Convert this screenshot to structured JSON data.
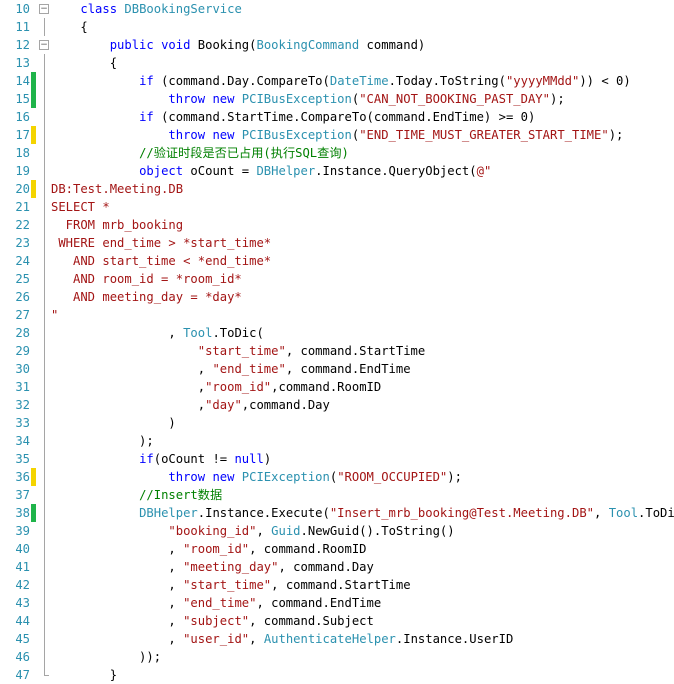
{
  "editor": {
    "colors": {
      "keyword": "#0000ff",
      "type": "#2b91af",
      "string": "#a31515",
      "comment": "#008000",
      "line_number": "#2b91af",
      "change_saved": "#1fb44a",
      "change_unsaved": "#f4d400"
    },
    "lines": [
      {
        "num": "10",
        "fold": "minus",
        "change": "",
        "code": [
          [
            "    ",
            "pl"
          ],
          [
            "class",
            "kw"
          ],
          [
            " ",
            "pl"
          ],
          [
            "DBBookingService",
            "ty"
          ]
        ]
      },
      {
        "num": "11",
        "fold": "line",
        "change": "",
        "code": [
          [
            "    {",
            "pl"
          ]
        ]
      },
      {
        "num": "12",
        "fold": "minus",
        "change": "",
        "code": [
          [
            "        ",
            "pl"
          ],
          [
            "public",
            "kw"
          ],
          [
            " ",
            "pl"
          ],
          [
            "void",
            "kw"
          ],
          [
            " Booking(",
            "pl"
          ],
          [
            "BookingCommand",
            "ty"
          ],
          [
            " command)",
            "pl"
          ]
        ]
      },
      {
        "num": "13",
        "fold": "line",
        "change": "",
        "code": [
          [
            "        {",
            "pl"
          ]
        ]
      },
      {
        "num": "14",
        "fold": "line",
        "change": "green",
        "code": [
          [
            "            ",
            "pl"
          ],
          [
            "if",
            "kw"
          ],
          [
            " (command.Day.CompareTo(",
            "pl"
          ],
          [
            "DateTime",
            "ty"
          ],
          [
            ".Today.ToString(",
            "pl"
          ],
          [
            "\"yyyyMMdd\"",
            "st"
          ],
          [
            ")) < 0)",
            "pl"
          ]
        ]
      },
      {
        "num": "15",
        "fold": "line",
        "change": "green",
        "code": [
          [
            "                ",
            "pl"
          ],
          [
            "throw",
            "kw"
          ],
          [
            " ",
            "pl"
          ],
          [
            "new",
            "kw"
          ],
          [
            " ",
            "pl"
          ],
          [
            "PCIBusException",
            "ty"
          ],
          [
            "(",
            "pl"
          ],
          [
            "\"CAN_NOT_BOOKING_PAST_DAY\"",
            "st"
          ],
          [
            ");",
            "pl"
          ]
        ]
      },
      {
        "num": "16",
        "fold": "line",
        "change": "",
        "code": [
          [
            "            ",
            "pl"
          ],
          [
            "if",
            "kw"
          ],
          [
            " (command.StartTime.CompareTo(command.EndTime) >= 0)",
            "pl"
          ]
        ]
      },
      {
        "num": "17",
        "fold": "line",
        "change": "yellow",
        "code": [
          [
            "                ",
            "pl"
          ],
          [
            "throw",
            "kw"
          ],
          [
            " ",
            "pl"
          ],
          [
            "new",
            "kw"
          ],
          [
            " ",
            "pl"
          ],
          [
            "PCIBusException",
            "ty"
          ],
          [
            "(",
            "pl"
          ],
          [
            "\"END_TIME_MUST_GREATER_START_TIME\"",
            "st"
          ],
          [
            ");",
            "pl"
          ]
        ]
      },
      {
        "num": "18",
        "fold": "line",
        "change": "",
        "code": [
          [
            "            ",
            "pl"
          ],
          [
            "//验证时段是否已占用(执行SQL查询)",
            "cm"
          ]
        ]
      },
      {
        "num": "19",
        "fold": "line",
        "change": "",
        "code": [
          [
            "            ",
            "pl"
          ],
          [
            "object",
            "kw"
          ],
          [
            " oCount = ",
            "pl"
          ],
          [
            "DBHelper",
            "ty"
          ],
          [
            ".Instance.QueryObject(",
            "pl"
          ],
          [
            "@\"",
            "st"
          ]
        ]
      },
      {
        "num": "20",
        "fold": "line",
        "change": "yellow",
        "code": [
          [
            "DB:Test.Meeting.DB",
            "st"
          ]
        ]
      },
      {
        "num": "21",
        "fold": "line",
        "change": "",
        "code": [
          [
            "SELECT *",
            "st"
          ]
        ]
      },
      {
        "num": "22",
        "fold": "line",
        "change": "",
        "code": [
          [
            "  FROM mrb_booking",
            "st"
          ]
        ]
      },
      {
        "num": "23",
        "fold": "line",
        "change": "",
        "code": [
          [
            " WHERE end_time > *start_time*",
            "st"
          ]
        ]
      },
      {
        "num": "24",
        "fold": "line",
        "change": "",
        "code": [
          [
            "   AND start_time < *end_time*",
            "st"
          ]
        ]
      },
      {
        "num": "25",
        "fold": "line",
        "change": "",
        "code": [
          [
            "   AND room_id = *room_id*",
            "st"
          ]
        ]
      },
      {
        "num": "26",
        "fold": "line",
        "change": "",
        "code": [
          [
            "   AND meeting_day = *day*",
            "st"
          ]
        ]
      },
      {
        "num": "27",
        "fold": "line",
        "change": "",
        "code": [
          [
            "\"",
            "st"
          ]
        ]
      },
      {
        "num": "28",
        "fold": "line",
        "change": "",
        "code": [
          [
            "                , ",
            "pl"
          ],
          [
            "Tool",
            "ty"
          ],
          [
            ".ToDic(",
            "pl"
          ]
        ]
      },
      {
        "num": "29",
        "fold": "line",
        "change": "",
        "code": [
          [
            "                    ",
            "pl"
          ],
          [
            "\"start_time\"",
            "st"
          ],
          [
            ", command.StartTime",
            "pl"
          ]
        ]
      },
      {
        "num": "30",
        "fold": "line",
        "change": "",
        "code": [
          [
            "                    , ",
            "pl"
          ],
          [
            "\"end_time\"",
            "st"
          ],
          [
            ", command.EndTime",
            "pl"
          ]
        ]
      },
      {
        "num": "31",
        "fold": "line",
        "change": "",
        "code": [
          [
            "                    ,",
            "pl"
          ],
          [
            "\"room_id\"",
            "st"
          ],
          [
            ",command.RoomID",
            "pl"
          ]
        ]
      },
      {
        "num": "32",
        "fold": "line",
        "change": "",
        "code": [
          [
            "                    ,",
            "pl"
          ],
          [
            "\"day\"",
            "st"
          ],
          [
            ",command.Day",
            "pl"
          ]
        ]
      },
      {
        "num": "33",
        "fold": "line",
        "change": "",
        "code": [
          [
            "                )",
            "pl"
          ]
        ]
      },
      {
        "num": "34",
        "fold": "line",
        "change": "",
        "code": [
          [
            "            );",
            "pl"
          ]
        ]
      },
      {
        "num": "35",
        "fold": "line",
        "change": "",
        "code": [
          [
            "            ",
            "pl"
          ],
          [
            "if",
            "kw"
          ],
          [
            "(oCount != ",
            "pl"
          ],
          [
            "null",
            "kw"
          ],
          [
            ")",
            "pl"
          ]
        ]
      },
      {
        "num": "36",
        "fold": "line",
        "change": "yellow",
        "code": [
          [
            "                ",
            "pl"
          ],
          [
            "throw",
            "kw"
          ],
          [
            " ",
            "pl"
          ],
          [
            "new",
            "kw"
          ],
          [
            " ",
            "pl"
          ],
          [
            "PCIException",
            "ty"
          ],
          [
            "(",
            "pl"
          ],
          [
            "\"ROOM_OCCUPIED\"",
            "st"
          ],
          [
            ");",
            "pl"
          ]
        ]
      },
      {
        "num": "37",
        "fold": "line",
        "change": "",
        "code": [
          [
            "            ",
            "pl"
          ],
          [
            "//Insert数据",
            "cm"
          ]
        ]
      },
      {
        "num": "38",
        "fold": "line",
        "change": "green",
        "code": [
          [
            "            ",
            "pl"
          ],
          [
            "DBHelper",
            "ty"
          ],
          [
            ".Instance.Execute(",
            "pl"
          ],
          [
            "\"Insert_mrb_booking@Test.Meeting.DB\"",
            "st"
          ],
          [
            ", ",
            "pl"
          ],
          [
            "Tool",
            "ty"
          ],
          [
            ".ToDic(",
            "pl"
          ]
        ]
      },
      {
        "num": "39",
        "fold": "line",
        "change": "",
        "code": [
          [
            "                ",
            "pl"
          ],
          [
            "\"booking_id\"",
            "st"
          ],
          [
            ", ",
            "pl"
          ],
          [
            "Guid",
            "ty"
          ],
          [
            ".NewGuid().ToString()",
            "pl"
          ]
        ]
      },
      {
        "num": "40",
        "fold": "line",
        "change": "",
        "code": [
          [
            "                , ",
            "pl"
          ],
          [
            "\"room_id\"",
            "st"
          ],
          [
            ", command.RoomID",
            "pl"
          ]
        ]
      },
      {
        "num": "41",
        "fold": "line",
        "change": "",
        "code": [
          [
            "                , ",
            "pl"
          ],
          [
            "\"meeting_day\"",
            "st"
          ],
          [
            ", command.Day",
            "pl"
          ]
        ]
      },
      {
        "num": "42",
        "fold": "line",
        "change": "",
        "code": [
          [
            "                , ",
            "pl"
          ],
          [
            "\"start_time\"",
            "st"
          ],
          [
            ", command.StartTime",
            "pl"
          ]
        ]
      },
      {
        "num": "43",
        "fold": "line",
        "change": "",
        "code": [
          [
            "                , ",
            "pl"
          ],
          [
            "\"end_time\"",
            "st"
          ],
          [
            ", command.EndTime",
            "pl"
          ]
        ]
      },
      {
        "num": "44",
        "fold": "line",
        "change": "",
        "code": [
          [
            "                , ",
            "pl"
          ],
          [
            "\"subject\"",
            "st"
          ],
          [
            ", command.Subject",
            "pl"
          ]
        ]
      },
      {
        "num": "45",
        "fold": "line",
        "change": "",
        "code": [
          [
            "                , ",
            "pl"
          ],
          [
            "\"user_id\"",
            "st"
          ],
          [
            ", ",
            "pl"
          ],
          [
            "AuthenticateHelper",
            "ty"
          ],
          [
            ".Instance.UserID",
            "pl"
          ]
        ]
      },
      {
        "num": "46",
        "fold": "line",
        "change": "",
        "code": [
          [
            "            ));",
            "pl"
          ]
        ]
      },
      {
        "num": "47",
        "fold": "end",
        "change": "",
        "code": [
          [
            "        }",
            "pl"
          ]
        ]
      }
    ]
  }
}
